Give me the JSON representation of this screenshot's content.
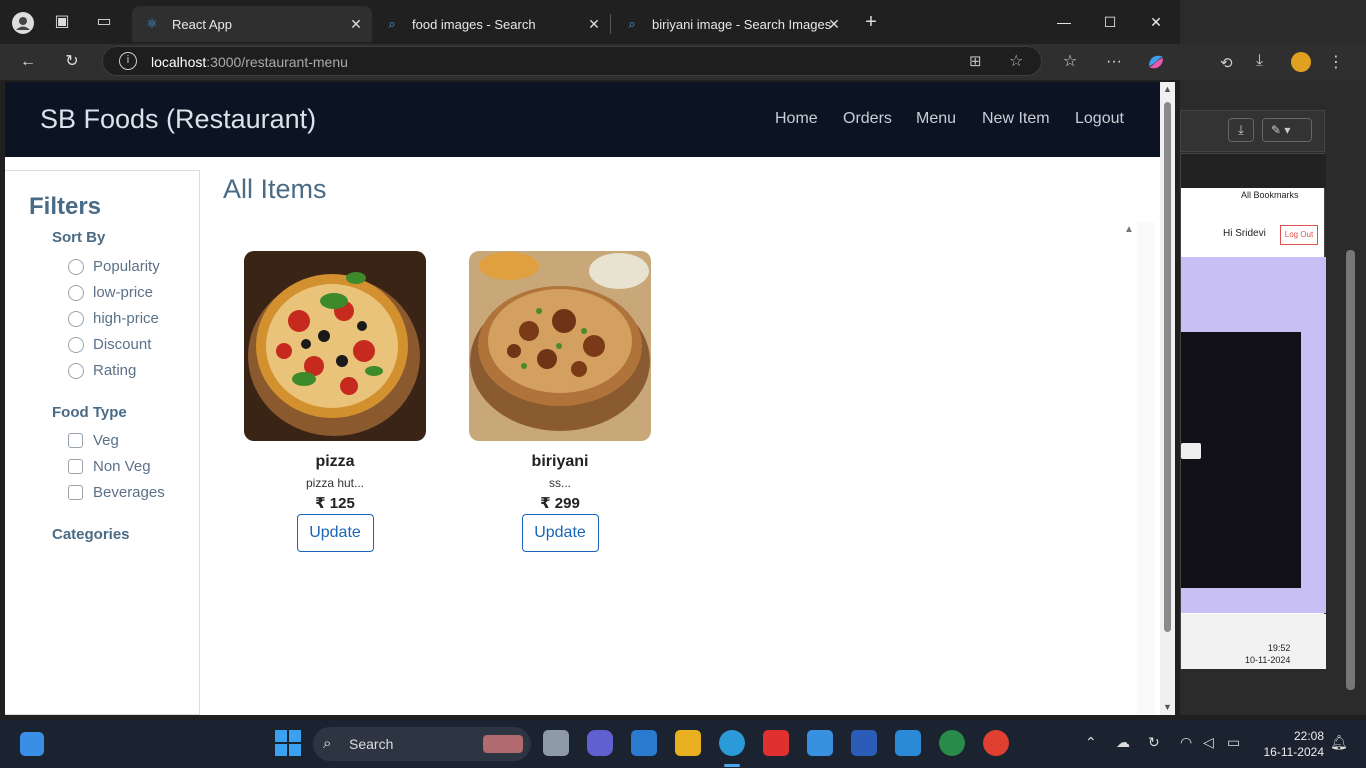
{
  "browser": {
    "tabs": [
      {
        "title": "React App",
        "icon": "react-icon"
      },
      {
        "title": "food images - Search",
        "icon": "search-icon"
      },
      {
        "title": "biriyani image - Search Images",
        "icon": "search-icon"
      }
    ],
    "url_host": "localhost",
    "url_path": ":3000/restaurant-menu"
  },
  "navbar": {
    "brand": "SB Foods (Restaurant)",
    "links": [
      "Home",
      "Orders",
      "Menu",
      "New Item",
      "Logout"
    ]
  },
  "filters": {
    "title": "Filters",
    "sort_by": {
      "label": "Sort By",
      "options": [
        "Popularity",
        "low-price",
        "high-price",
        "Discount",
        "Rating"
      ]
    },
    "food_type": {
      "label": "Food Type",
      "options": [
        "Veg",
        "Non Veg",
        "Beverages"
      ]
    },
    "categories": {
      "label": "Categories"
    }
  },
  "main": {
    "title": "All Items",
    "items": [
      {
        "name": "pizza",
        "description": "pizza hut...",
        "price": "₹ 125",
        "button": "Update"
      },
      {
        "name": "biriyani",
        "description": "ss...",
        "price": "₹ 299",
        "button": "Update"
      }
    ]
  },
  "background_window": {
    "greeting": "Hi Sridevi",
    "logout": "Log Out",
    "bookmarks": "All Bookmarks",
    "time": "19:52",
    "date": "10-11-2024"
  },
  "taskbar": {
    "search_placeholder": "Search",
    "time": "22:08",
    "date": "16-11-2024"
  }
}
